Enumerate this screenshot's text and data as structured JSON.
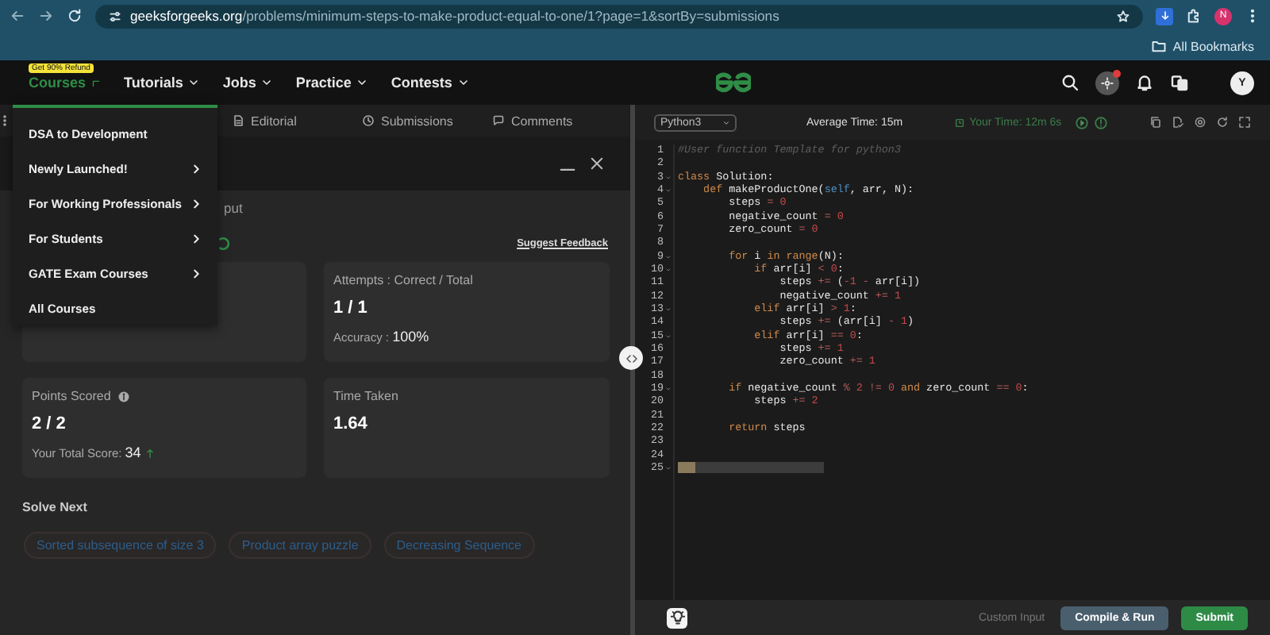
{
  "browser": {
    "url_host": "geeksforgeeks.org",
    "url_path": "/problems/minimum-steps-to-make-product-equal-to-one/1?page=1&sortBy=submissions",
    "profile_initial": "N",
    "bookmarks_label": "All Bookmarks"
  },
  "nav": {
    "badge": "Get 90% Refund",
    "items": [
      {
        "label": "Courses",
        "selected": true,
        "expanded": true
      },
      {
        "label": "Tutorials",
        "selected": false,
        "expanded": false
      },
      {
        "label": "Jobs",
        "selected": false,
        "expanded": false
      },
      {
        "label": "Practice",
        "selected": false,
        "expanded": false
      },
      {
        "label": "Contests",
        "selected": false,
        "expanded": false
      }
    ],
    "user_initial": "Y",
    "has_notification": true
  },
  "problem_tabs": [
    {
      "label": "Editorial",
      "kind": "document"
    },
    {
      "label": "Submissions",
      "kind": "clock"
    },
    {
      "label": "Comments",
      "kind": "chat"
    }
  ],
  "result_panel": {
    "tab": "put",
    "feedback_link": "Suggest Feedback",
    "attempts": {
      "title": "Attempts : Correct / Total",
      "value": "1 / 1",
      "note_label": "Accuracy : ",
      "note_value": "100%"
    },
    "points": {
      "title": "Points Scored",
      "value": "2 / 2",
      "note_label": "Your Total Score: ",
      "note_value": "34"
    },
    "time": {
      "title": "Time Taken",
      "value": "1.64"
    },
    "solve_next": {
      "title": "Solve Next",
      "items": [
        "Sorted subsequence of size 3",
        "Product array puzzle",
        "Decreasing Sequence"
      ]
    }
  },
  "menu": {
    "items": [
      {
        "label": "DSA to Development",
        "has_submenu": false
      },
      {
        "label": "Newly Launched!",
        "has_submenu": true
      },
      {
        "label": "For Working Professionals",
        "has_submenu": true
      },
      {
        "label": "For Students",
        "has_submenu": true
      },
      {
        "label": "GATE Exam Courses",
        "has_submenu": true
      },
      {
        "label": "All Courses",
        "has_submenu": false
      }
    ]
  },
  "editor": {
    "language": "Python3",
    "average_time": "Average Time: 15m",
    "your_time": "Your Time: 12m 6s",
    "lines": [
      {
        "number": "1",
        "foldable": false,
        "tokens": [
          {
            "kind": "comment",
            "text": "#User function Template for python3"
          }
        ]
      },
      {
        "number": "2",
        "foldable": false
      },
      {
        "number": "3",
        "foldable": true,
        "tokens": [
          {
            "kind": "keyword",
            "text": "class"
          },
          {
            "kind": "plain",
            "text": " Solution:"
          }
        ]
      },
      {
        "number": "4",
        "foldable": true,
        "tokens": [
          {
            "kind": "keyword",
            "text": "    def"
          },
          {
            "kind": "plain",
            "text": " makeProductOne("
          },
          {
            "kind": "self",
            "text": "self"
          },
          {
            "kind": "plain",
            "text": ", arr, N):"
          }
        ]
      },
      {
        "number": "5",
        "foldable": false,
        "tokens": [
          {
            "kind": "plain",
            "text": "        steps "
          },
          {
            "kind": "op",
            "text": "="
          },
          {
            "kind": "number",
            "text": " 0"
          }
        ]
      },
      {
        "number": "6",
        "foldable": false,
        "tokens": [
          {
            "kind": "plain",
            "text": "        negative_count "
          },
          {
            "kind": "op",
            "text": "="
          },
          {
            "kind": "number",
            "text": " 0"
          }
        ]
      },
      {
        "number": "7",
        "foldable": false,
        "tokens": [
          {
            "kind": "plain",
            "text": "        zero_count "
          },
          {
            "kind": "op",
            "text": "="
          },
          {
            "kind": "number",
            "text": " 0"
          }
        ]
      },
      {
        "number": "8",
        "foldable": false
      },
      {
        "number": "9",
        "foldable": true,
        "tokens": [
          {
            "kind": "keyword",
            "text": "        for"
          },
          {
            "kind": "plain",
            "text": " i "
          },
          {
            "kind": "keyword",
            "text": "in"
          },
          {
            "kind": "keyword",
            "text": " range"
          },
          {
            "kind": "plain",
            "text": "(N):"
          }
        ]
      },
      {
        "number": "10",
        "foldable": true,
        "tokens": [
          {
            "kind": "keyword",
            "text": "            if"
          },
          {
            "kind": "plain",
            "text": " arr[i] "
          },
          {
            "kind": "op",
            "text": "<"
          },
          {
            "kind": "number",
            "text": " 0"
          },
          {
            "kind": "plain",
            "text": ":"
          }
        ]
      },
      {
        "number": "11",
        "foldable": false,
        "tokens": [
          {
            "kind": "plain",
            "text": "                steps "
          },
          {
            "kind": "op",
            "text": "+="
          },
          {
            "kind": "plain",
            "text": " ("
          },
          {
            "kind": "number",
            "text": "-1"
          },
          {
            "kind": "op",
            "text": " -"
          },
          {
            "kind": "plain",
            "text": " arr[i])"
          }
        ]
      },
      {
        "number": "12",
        "foldable": false,
        "tokens": [
          {
            "kind": "plain",
            "text": "                negative_count "
          },
          {
            "kind": "op",
            "text": "+="
          },
          {
            "kind": "number",
            "text": " 1"
          }
        ]
      },
      {
        "number": "13",
        "foldable": true,
        "tokens": [
          {
            "kind": "keyword",
            "text": "            elif"
          },
          {
            "kind": "plain",
            "text": " arr[i] "
          },
          {
            "kind": "op",
            "text": ">"
          },
          {
            "kind": "number",
            "text": " 1"
          },
          {
            "kind": "plain",
            "text": ":"
          }
        ]
      },
      {
        "number": "14",
        "foldable": false,
        "tokens": [
          {
            "kind": "plain",
            "text": "                steps "
          },
          {
            "kind": "op",
            "text": "+="
          },
          {
            "kind": "plain",
            "text": " (arr[i] "
          },
          {
            "kind": "op",
            "text": "-"
          },
          {
            "kind": "number",
            "text": " 1"
          },
          {
            "kind": "plain",
            "text": ")"
          }
        ]
      },
      {
        "number": "15",
        "foldable": true,
        "tokens": [
          {
            "kind": "keyword",
            "text": "            elif"
          },
          {
            "kind": "plain",
            "text": " arr[i] "
          },
          {
            "kind": "op",
            "text": "=="
          },
          {
            "kind": "number",
            "text": " 0"
          },
          {
            "kind": "plain",
            "text": ":"
          }
        ]
      },
      {
        "number": "16",
        "foldable": false,
        "tokens": [
          {
            "kind": "plain",
            "text": "                steps "
          },
          {
            "kind": "op",
            "text": "+="
          },
          {
            "kind": "number",
            "text": " 1"
          }
        ]
      },
      {
        "number": "17",
        "foldable": false,
        "tokens": [
          {
            "kind": "plain",
            "text": "                zero_count "
          },
          {
            "kind": "op",
            "text": "+="
          },
          {
            "kind": "number",
            "text": " 1"
          }
        ]
      },
      {
        "number": "18",
        "foldable": false
      },
      {
        "number": "19",
        "foldable": true,
        "tokens": [
          {
            "kind": "keyword",
            "text": "        if"
          },
          {
            "kind": "plain",
            "text": " negative_count "
          },
          {
            "kind": "op",
            "text": "%"
          },
          {
            "kind": "number",
            "text": " 2"
          },
          {
            "kind": "op",
            "text": " !="
          },
          {
            "kind": "number",
            "text": " 0"
          },
          {
            "kind": "keyword",
            "text": " and"
          },
          {
            "kind": "plain",
            "text": " zero_count "
          },
          {
            "kind": "op",
            "text": "=="
          },
          {
            "kind": "number",
            "text": " 0"
          },
          {
            "kind": "plain",
            "text": ":"
          }
        ]
      },
      {
        "number": "20",
        "foldable": false,
        "tokens": [
          {
            "kind": "plain",
            "text": "            steps "
          },
          {
            "kind": "op",
            "text": "+="
          },
          {
            "kind": "number",
            "text": " 2"
          }
        ]
      },
      {
        "number": "21",
        "foldable": false
      },
      {
        "number": "22",
        "foldable": false,
        "tokens": [
          {
            "kind": "keyword",
            "text": "        return"
          },
          {
            "kind": "plain",
            "text": " steps"
          }
        ]
      },
      {
        "number": "23",
        "foldable": false
      },
      {
        "number": "24",
        "foldable": false
      },
      {
        "number": "25",
        "foldable": true,
        "selection": true
      }
    ],
    "custom_input": "Custom Input",
    "compile_button": "Compile & Run",
    "submit_button": "Submit"
  }
}
